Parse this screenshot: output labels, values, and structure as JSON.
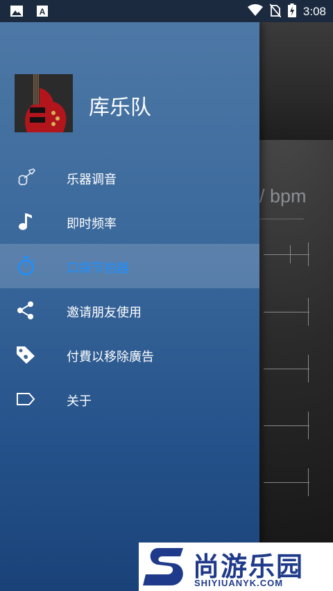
{
  "status_bar": {
    "time": "3:08",
    "icons": [
      "image-icon",
      "a-icon",
      "wifi-icon",
      "no-sim-icon",
      "battery-charging-icon"
    ]
  },
  "drawer": {
    "app_name": "库乐队",
    "items": [
      {
        "label": "乐器调音",
        "icon": "guitar-icon",
        "active": false
      },
      {
        "label": "即时频率",
        "icon": "music-note-icon",
        "active": false
      },
      {
        "label": "口袋节拍器",
        "icon": "stopwatch-icon",
        "active": true
      },
      {
        "label": "邀请朋友使用",
        "icon": "share-icon",
        "active": false
      },
      {
        "label": "付費以移除廣告",
        "icon": "tag-icon",
        "active": false
      },
      {
        "label": "关于",
        "icon": "label-icon",
        "active": false
      }
    ]
  },
  "background": {
    "bpm_text": "/ bpm"
  },
  "watermark": {
    "title": "尚游乐园",
    "subtitle": "SHIYIUANYK.COM"
  },
  "colors": {
    "accent": "#1e90ff",
    "drawer_top": "#4d78a6",
    "drawer_bottom": "#1a4279"
  }
}
